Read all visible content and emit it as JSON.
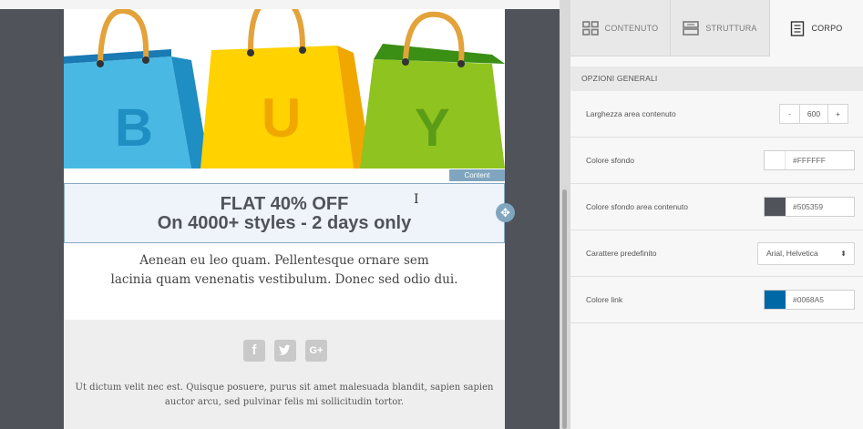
{
  "email": {
    "hero_letters": [
      "B",
      "U",
      "Y"
    ],
    "content_tag": "Content",
    "headline_line1": "FLAT 40% OFF",
    "headline_line2": "On 4000+ styles - 2 days only",
    "body_line1": "Aenean eu leo quam. Pellentesque ornare sem",
    "body_line2": "lacinia quam venenatis vestibulum. Donec sed odio dui.",
    "social": {
      "facebook": "f",
      "twitter": "t",
      "googleplus": "G+"
    },
    "footer_line1": "Ut dictum velit nec est. Quisque posuere, purus sit amet malesuada blandit, sapien sapien",
    "footer_line2": "auctor arcu, sed pulvinar felis mi sollicitudin tortor."
  },
  "panel": {
    "tabs": [
      {
        "label": "CONTENUTO",
        "icon": "grid-icon",
        "active": false
      },
      {
        "label": "STRUTTURA",
        "icon": "rows-icon",
        "active": false
      },
      {
        "label": "CORPO",
        "icon": "document-icon",
        "active": true
      }
    ],
    "section_title": "OPZIONI GENERALI",
    "rows": {
      "width": {
        "label": "Larghezza area contenuto",
        "minus": "-",
        "value": "600",
        "plus": "+"
      },
      "bg": {
        "label": "Colore sfondo",
        "value": "#FFFFFF",
        "color": "#FFFFFF"
      },
      "content_bg": {
        "label": "Colore sfondo area contenuto",
        "value": "#505359",
        "color": "#505359"
      },
      "font": {
        "label": "Carattere predefinito",
        "value": "Arial, Helvetica"
      },
      "link": {
        "label": "Colore link",
        "value": "#0068A5",
        "color": "#0068A5"
      }
    }
  },
  "colors": {
    "canvas_bg": "#505359",
    "accent": "#7fa6be"
  }
}
